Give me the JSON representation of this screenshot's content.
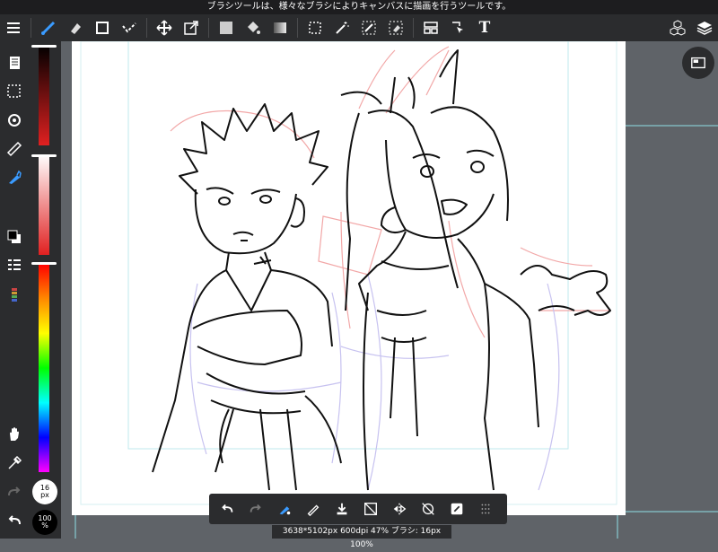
{
  "hint_text": "ブラシツールは、様々なブラシによりキャンバスに描画を行うツールです。",
  "status_text": "3638*5102px 600dpi 47% ブラシ: 16px 100%",
  "brush_size": {
    "value": "16",
    "unit": "px"
  },
  "brush_opacity": {
    "value": "100",
    "unit": "%"
  },
  "toolbar": {
    "text_tool_label": "T"
  },
  "colors": {
    "accent": "#3a9bff",
    "panel": "#2b2c2e",
    "hint_bar": "#1d1d1f",
    "canvas_bg": "#5f6368",
    "guide_cyan": "#8fdfe6"
  },
  "icons": {
    "top": [
      "menu-icon",
      "brush-icon",
      "eraser-icon",
      "rectangle-icon",
      "correction-icon",
      "move-icon",
      "transform-icon",
      "fill-color-icon",
      "bucket-icon",
      "gradient-icon",
      "select-icon",
      "magic-wand-icon",
      "select-pen-icon",
      "select-eraser-icon",
      "layout-icon",
      "pointer-icon",
      "text-icon",
      "materials-icon",
      "layers-icon"
    ],
    "left": [
      "page-icon",
      "selection-icon",
      "rotate-icon",
      "ruler-icon",
      "brush-tool-icon",
      "color-icon",
      "layer-list-icon",
      "palette-icon",
      "hand-icon",
      "eyedropper-icon",
      "redo-icon",
      "undo-icon"
    ],
    "bottom": [
      "undo-icon",
      "redo-icon",
      "brush-settings-icon",
      "pen-icon",
      "download-icon",
      "clear-icon",
      "flip-icon",
      "rotate-disable-icon",
      "snap-icon",
      "grid-icon"
    ]
  }
}
